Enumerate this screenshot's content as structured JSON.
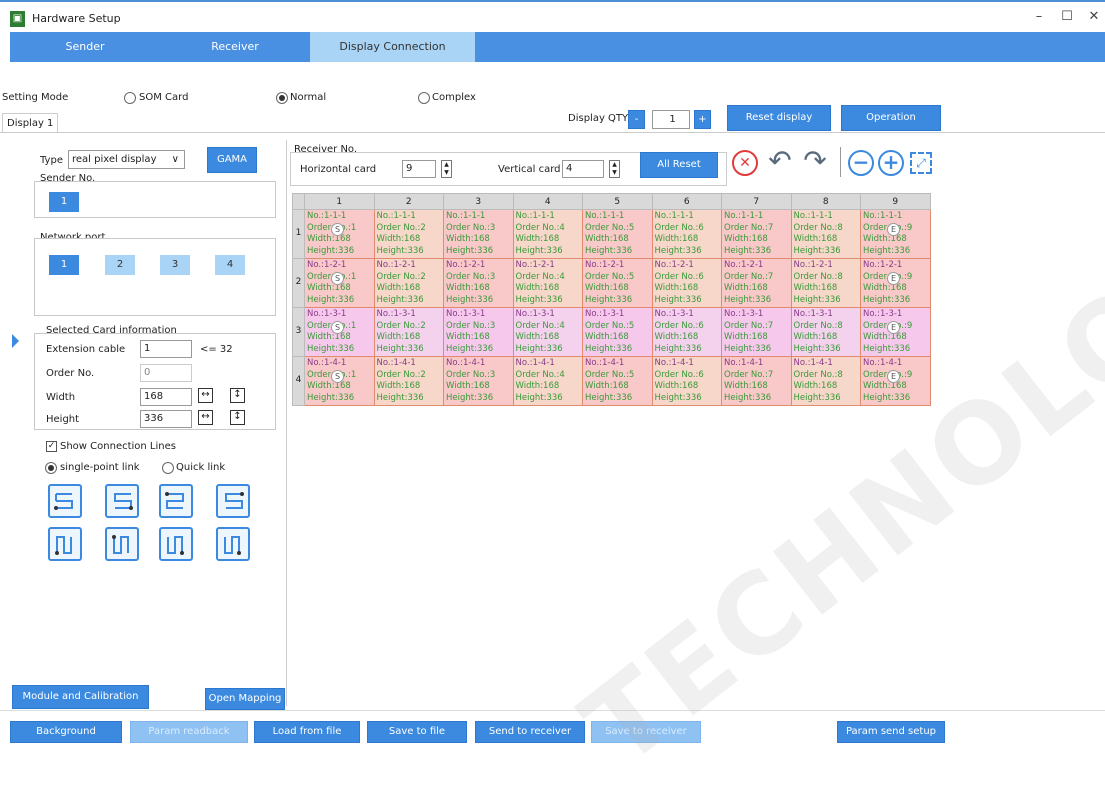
{
  "window": {
    "title": "Hardware Setup",
    "app_icon": "hardware-icon",
    "min": "–",
    "max": "☐",
    "close": "✕"
  },
  "tabs": [
    {
      "label": "Sender"
    },
    {
      "label": "Receiver"
    },
    {
      "label": "Display Connection"
    }
  ],
  "setting_mode": {
    "label": "Setting Mode",
    "options": [
      {
        "label": "SOM Card",
        "selected": false
      },
      {
        "label": "Normal",
        "selected": true
      },
      {
        "label": "Complex",
        "selected": false
      }
    ]
  },
  "display_tab": "Display 1",
  "display_qty": {
    "label": "Display QTY",
    "minus": "-",
    "value": "1",
    "plus": "+"
  },
  "buttons": {
    "reset_display": "Reset display",
    "operation": "Operation",
    "gama": "GAMA",
    "all_reset": "All Reset"
  },
  "type": {
    "label": "Type",
    "value": "real pixel display",
    "arrow": "∨"
  },
  "sender_no": {
    "label": "Sender No.",
    "value": "1"
  },
  "network_port": {
    "label": "Network port",
    "ports": [
      "1",
      "2",
      "3",
      "4"
    ]
  },
  "selected_card": {
    "title": "Selected Card information",
    "extension_cable": {
      "label": "Extension cable",
      "value": "1",
      "hint": "<= 32"
    },
    "order_no": {
      "label": "Order No.",
      "value": "0"
    },
    "width": {
      "label": "Width",
      "value": "168"
    },
    "height": {
      "label": "Height",
      "value": "336"
    }
  },
  "show_connection_lines": "Show Connection Lines",
  "link_modes": [
    {
      "label": "single-point link",
      "selected": true
    },
    {
      "label": "Quick link",
      "selected": false
    }
  ],
  "receiver_no": {
    "label": "Receiver No.",
    "horizontal": {
      "label": "Horizontal card",
      "value": "9"
    },
    "vertical": {
      "label": "Vertical card",
      "value": "4"
    }
  },
  "toolbar_icons": [
    "clear-icon",
    "undo-icon",
    "redo-icon",
    "zoom-out-icon",
    "zoom-in-icon",
    "fit-screen-icon"
  ],
  "grid": {
    "columns": [
      "1",
      "2",
      "3",
      "4",
      "5",
      "6",
      "7",
      "8",
      "9"
    ],
    "rows": [
      {
        "label": "1",
        "cells": [
          [
            "No.:1-1-1",
            "Order No.:1",
            "Width:168",
            "Height:336"
          ],
          [
            "No.:1-1-1",
            "Order No.:2",
            "Width:168",
            "Height:336"
          ],
          [
            "No.:1-1-1",
            "Order No.:3",
            "Width:168",
            "Height:336"
          ],
          [
            "No.:1-1-1",
            "Order No.:4",
            "Width:168",
            "Height:336"
          ],
          [
            "No.:1-1-1",
            "Order No.:5",
            "Width:168",
            "Height:336"
          ],
          [
            "No.:1-1-1",
            "Order No.:6",
            "Width:168",
            "Height:336"
          ],
          [
            "No.:1-1-1",
            "Order No.:7",
            "Width:168",
            "Height:336"
          ],
          [
            "No.:1-1-1",
            "Order No.:8",
            "Width:168",
            "Height:336"
          ],
          [
            "No.:1-1-1",
            "Order No.:9",
            "Width:168",
            "Height:336"
          ]
        ]
      },
      {
        "label": "2",
        "cells": [
          [
            "No.:1-2-1",
            "Order No.:1",
            "Width:168",
            "Height:336"
          ],
          [
            "No.:1-2-1",
            "Order No.:2",
            "Width:168",
            "Height:336"
          ],
          [
            "No.:1-2-1",
            "Order No.:3",
            "Width:168",
            "Height:336"
          ],
          [
            "No.:1-2-1",
            "Order No.:4",
            "Width:168",
            "Height:336"
          ],
          [
            "No.:1-2-1",
            "Order No.:5",
            "Width:168",
            "Height:336"
          ],
          [
            "No.:1-2-1",
            "Order No.:6",
            "Width:168",
            "Height:336"
          ],
          [
            "No.:1-2-1",
            "Order No.:7",
            "Width:168",
            "Height:336"
          ],
          [
            "No.:1-2-1",
            "Order No.:8",
            "Width:168",
            "Height:336"
          ],
          [
            "No.:1-2-1",
            "Order No.:9",
            "Width:168",
            "Height:336"
          ]
        ]
      },
      {
        "label": "3",
        "cells": [
          [
            "No.:1-3-1",
            "Order No.:1",
            "Width:168",
            "Height:336"
          ],
          [
            "No.:1-3-1",
            "Order No.:2",
            "Width:168",
            "Height:336"
          ],
          [
            "No.:1-3-1",
            "Order No.:3",
            "Width:168",
            "Height:336"
          ],
          [
            "No.:1-3-1",
            "Order No.:4",
            "Width:168",
            "Height:336"
          ],
          [
            "No.:1-3-1",
            "Order No.:5",
            "Width:168",
            "Height:336"
          ],
          [
            "No.:1-3-1",
            "Order No.:6",
            "Width:168",
            "Height:336"
          ],
          [
            "No.:1-3-1",
            "Order No.:7",
            "Width:168",
            "Height:336"
          ],
          [
            "No.:1-3-1",
            "Order No.:8",
            "Width:168",
            "Height:336"
          ],
          [
            "No.:1-3-1",
            "Order No.:9",
            "Width:168",
            "Height:336"
          ]
        ]
      },
      {
        "label": "4",
        "cells": [
          [
            "No.:1-4-1",
            "Order No.:1",
            "Width:168",
            "Height:336"
          ],
          [
            "No.:1-4-1",
            "Order No.:2",
            "Width:168",
            "Height:336"
          ],
          [
            "No.:1-4-1",
            "Order No.:3",
            "Width:168",
            "Height:336"
          ],
          [
            "No.:1-4-1",
            "Order No.:4",
            "Width:168",
            "Height:336"
          ],
          [
            "No.:1-4-1",
            "Order No.:5",
            "Width:168",
            "Height:336"
          ],
          [
            "No.:1-4-1",
            "Order No.:6",
            "Width:168",
            "Height:336"
          ],
          [
            "No.:1-4-1",
            "Order No.:7",
            "Width:168",
            "Height:336"
          ],
          [
            "No.:1-4-1",
            "Order No.:8",
            "Width:168",
            "Height:336"
          ],
          [
            "No.:1-4-1",
            "Order No.:9",
            "Width:168",
            "Height:336"
          ]
        ]
      }
    ],
    "start_marker": "S",
    "end_marker": "E",
    "colors": {
      "row_odd": "#f9c8c8",
      "row_even": "#f6d7c9",
      "row_pink": "#f6c9ec",
      "accent": "#3b8ae0"
    }
  },
  "bottom_left": {
    "module_calibration": "Module and Calibration",
    "open_mapping": "Open Mapping"
  },
  "footer": [
    {
      "label": "Background",
      "enabled": true
    },
    {
      "label": "Param readback",
      "enabled": false
    },
    {
      "label": "Load from file",
      "enabled": true
    },
    {
      "label": "Save to file",
      "enabled": true
    },
    {
      "label": "Send to receiver",
      "enabled": true
    },
    {
      "label": "Save to receiver",
      "enabled": false
    },
    {
      "label": "Param send setup",
      "enabled": true
    }
  ],
  "watermark": "TECHNOLOGY"
}
